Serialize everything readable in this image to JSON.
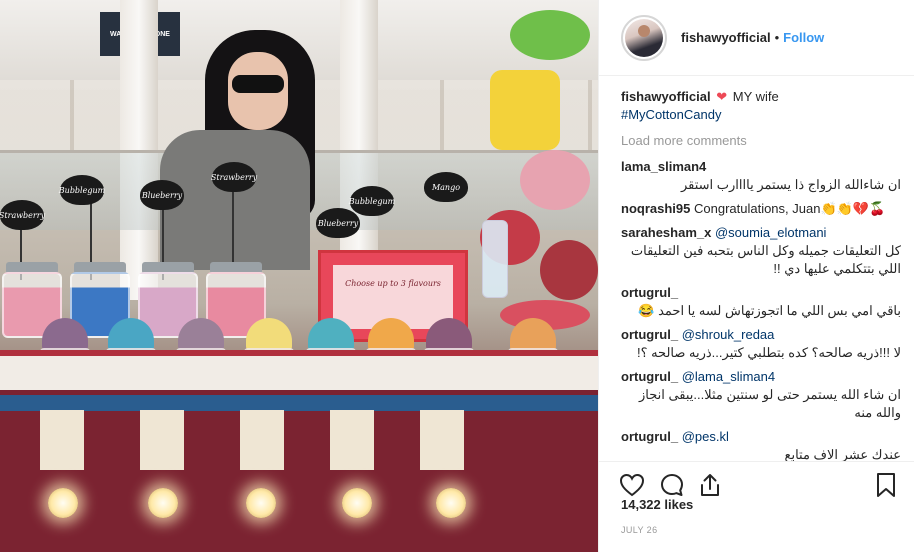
{
  "photo": {
    "shop_sign": "WARRIORS ZONE",
    "jar_signs": [
      "Strawberry",
      "Bubblegum",
      "Blueberry",
      "Strawberry"
    ],
    "cup_signs": [
      "Bubblegum",
      "Mango",
      "Blueberry"
    ],
    "menu_text": "Choose up to 3 flavours"
  },
  "header": {
    "username": "fishawyofficial",
    "separator": "•",
    "follow_label": "Follow"
  },
  "caption": {
    "username": "fishawyofficial",
    "text": "MY wife",
    "hashtag": "#MyCottonCandy"
  },
  "load_more": "Load more comments",
  "comments": [
    {
      "user": "lama_sliman4",
      "text": "ان شاءالله الزواج ذا يستمر ياااارب استقر"
    },
    {
      "user": "noqrashi95",
      "text": "Congratulations, Juan👏👏💔🍒"
    },
    {
      "user": "sarahesham_x",
      "mention": "@soumia_elotmani",
      "text": "كل التعليقات جميله وكل الناس بتحبه فين التعليقات اللي بتتكلمي عليها دي !!"
    },
    {
      "user": "ortugrul_",
      "text": "باقي امي بس اللي ما اتجوزتهاش لسه يا احمد 😂"
    },
    {
      "user": "ortugrul_",
      "mention": "@shrouk_redaa",
      "text": "لا !!!ذريه صالحه؟ كده بتطلبي كتير...ذريه صالحه ؟!"
    },
    {
      "user": "ortugrul_",
      "mention": "@lama_sliman4",
      "text": "ان شاء الله يستمر حتى لو سنتين مثلا...يبقى انجاز والله منه"
    },
    {
      "user": "ortugrul_",
      "mention": "@pes.kl",
      "text": "عندك عشر الاف متابع"
    }
  ],
  "actions": {
    "like_icon": "heart-icon",
    "comment_icon": "comment-icon",
    "share_icon": "share-icon",
    "save_icon": "bookmark-icon"
  },
  "likes": "14,322 likes",
  "date": "JULY 26",
  "colors": {
    "follow": "#3897f0",
    "hashtag": "#003569",
    "heart": "#ed4956",
    "muted": "#999999"
  }
}
